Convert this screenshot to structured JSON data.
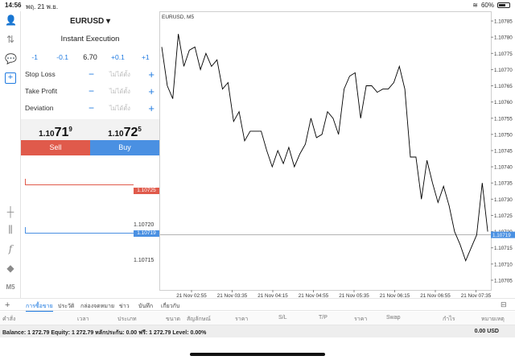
{
  "status_bar": {
    "time": "14:56",
    "date": "พฤ. 21 พ.ย.",
    "battery_pct": "60%",
    "battery_level": 0.6
  },
  "order": {
    "symbol": "EURUSD ▾",
    "execution": "Instant Execution",
    "volume": {
      "m1": "-1",
      "m01": "-0.1",
      "value": "6.70",
      "p01": "+0.1",
      "p1": "+1"
    },
    "params": [
      {
        "label": "Stop Loss",
        "placeholder": "ไม่ได้ตั้ง"
      },
      {
        "label": "Take Profit",
        "placeholder": "ไม่ได้ตั้ง"
      },
      {
        "label": "Deviation",
        "placeholder": "ไม่ได้ตั้ง"
      }
    ],
    "bid": {
      "prefix": "1.10",
      "big": "71",
      "sup": "9"
    },
    "ask": {
      "prefix": "1.10",
      "big": "72",
      "sup": "5"
    },
    "sell_label": "Sell",
    "buy_label": "Buy",
    "mini": {
      "ask_tag": "1.10725",
      "bid_tag": "1.10719",
      "tick_a": "1.10720",
      "tick_b": "1.10715",
      "ask_color": "#e05a4b",
      "bid_color": "#4a90e2"
    }
  },
  "chart_data": {
    "type": "line",
    "title": "EURUSD, M5",
    "x_ticks": [
      "21 Nov 02:55",
      "21 Nov 03:35",
      "21 Nov 04:15",
      "21 Nov 04:55",
      "21 Nov 05:35",
      "21 Nov 06:15",
      "21 Nov 06:55",
      "21 Nov 07:35"
    ],
    "y_ticks": [
      "1.10785",
      "1.10780",
      "1.10775",
      "1.10770",
      "1.10765",
      "1.10760",
      "1.10755",
      "1.10750",
      "1.10745",
      "1.10740",
      "1.10735",
      "1.10730",
      "1.10725",
      "1.10720",
      "1.10715",
      "1.10710",
      "1.10705"
    ],
    "ylim": [
      1.10702,
      1.10788
    ],
    "values": [
      1.10777,
      1.10765,
      1.10761,
      1.10781,
      1.10771,
      1.10776,
      1.10777,
      1.1077,
      1.10775,
      1.10771,
      1.10773,
      1.10764,
      1.10766,
      1.10754,
      1.10757,
      1.10748,
      1.10751,
      1.10751,
      1.10751,
      1.10745,
      1.1074,
      1.10745,
      1.10741,
      1.10746,
      1.1074,
      1.10744,
      1.10747,
      1.10755,
      1.10749,
      1.1075,
      1.10757,
      1.10755,
      1.1075,
      1.10764,
      1.10768,
      1.10769,
      1.10755,
      1.10765,
      1.10765,
      1.10763,
      1.10764,
      1.10764,
      1.10766,
      1.10771,
      1.10764,
      1.10743,
      1.10743,
      1.1073,
      1.10742,
      1.10735,
      1.10729,
      1.10734,
      1.10728,
      1.1072,
      1.10716,
      1.10711,
      1.10715,
      1.10719,
      1.10735,
      1.1072
    ],
    "current_price": "1.10719",
    "current_value": 1.10719,
    "line_color": "#000000",
    "bid_color": "#4a90e2"
  },
  "bottom": {
    "tabs": [
      "การซื้อขาย",
      "ประวัติ",
      "กล่องจดหมาย",
      "ข่าว",
      "บันทึก",
      "เกี่ยวกับ"
    ],
    "columns": [
      "คำสั่ง",
      "เวลา",
      "ประเภท",
      "ขนาด",
      "สัญลักษณ์",
      "ราคา",
      "S/L",
      "T/P",
      "ราคา",
      "Swap",
      "กำไร",
      "หมายเหตุ"
    ],
    "balance": "Balance: 1 272.79 Equity: 1 272.79 หลักประกัน: 0.00 ฟรี: 1 272.79 Level: 0.00%",
    "pl": "0.00  USD"
  },
  "icons": [
    "account-icon",
    "transfer-icon",
    "chat-icon",
    "new-order-icon",
    "crosshair-icon",
    "indicator-icon",
    "function-icon",
    "objects-icon",
    "timeframe-icon",
    "add-icon",
    "layout-icon"
  ],
  "left_timeframe": "M5"
}
